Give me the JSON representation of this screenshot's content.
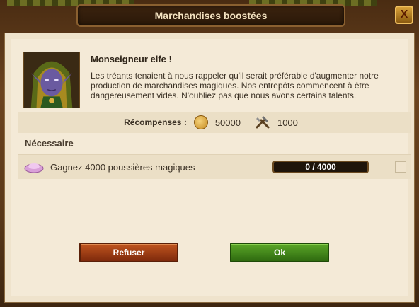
{
  "dialog": {
    "title": "Marchandises boostées",
    "close_label": "X"
  },
  "quest": {
    "npc_name": "Monseigneur elfe !",
    "text": "Les tréants tenaient à nous rappeler qu'il serait préférable d'augmenter notre production de marchandises magiques. Nos entrepôts commencent à être dangereusement vides. N'oubliez pas que nous avons certains talents."
  },
  "rewards": {
    "label": "Récompenses :",
    "coins": "50000",
    "supplies": "1000",
    "coin_icon": "coin-icon",
    "supplies_icon": "hammer-icon"
  },
  "requirements": {
    "title": "Nécessaire",
    "items": [
      {
        "icon": "magic-dust-icon",
        "text": "Gagnez 4000 poussières magiques",
        "progress": "0 / 4000",
        "progress_fraction": 0,
        "done": false
      }
    ]
  },
  "buttons": {
    "refuse": "Refuser",
    "ok": "Ok"
  },
  "colors": {
    "refuse": "#a0401a",
    "ok": "#4a8e1e",
    "panel": "#f4ead7"
  }
}
